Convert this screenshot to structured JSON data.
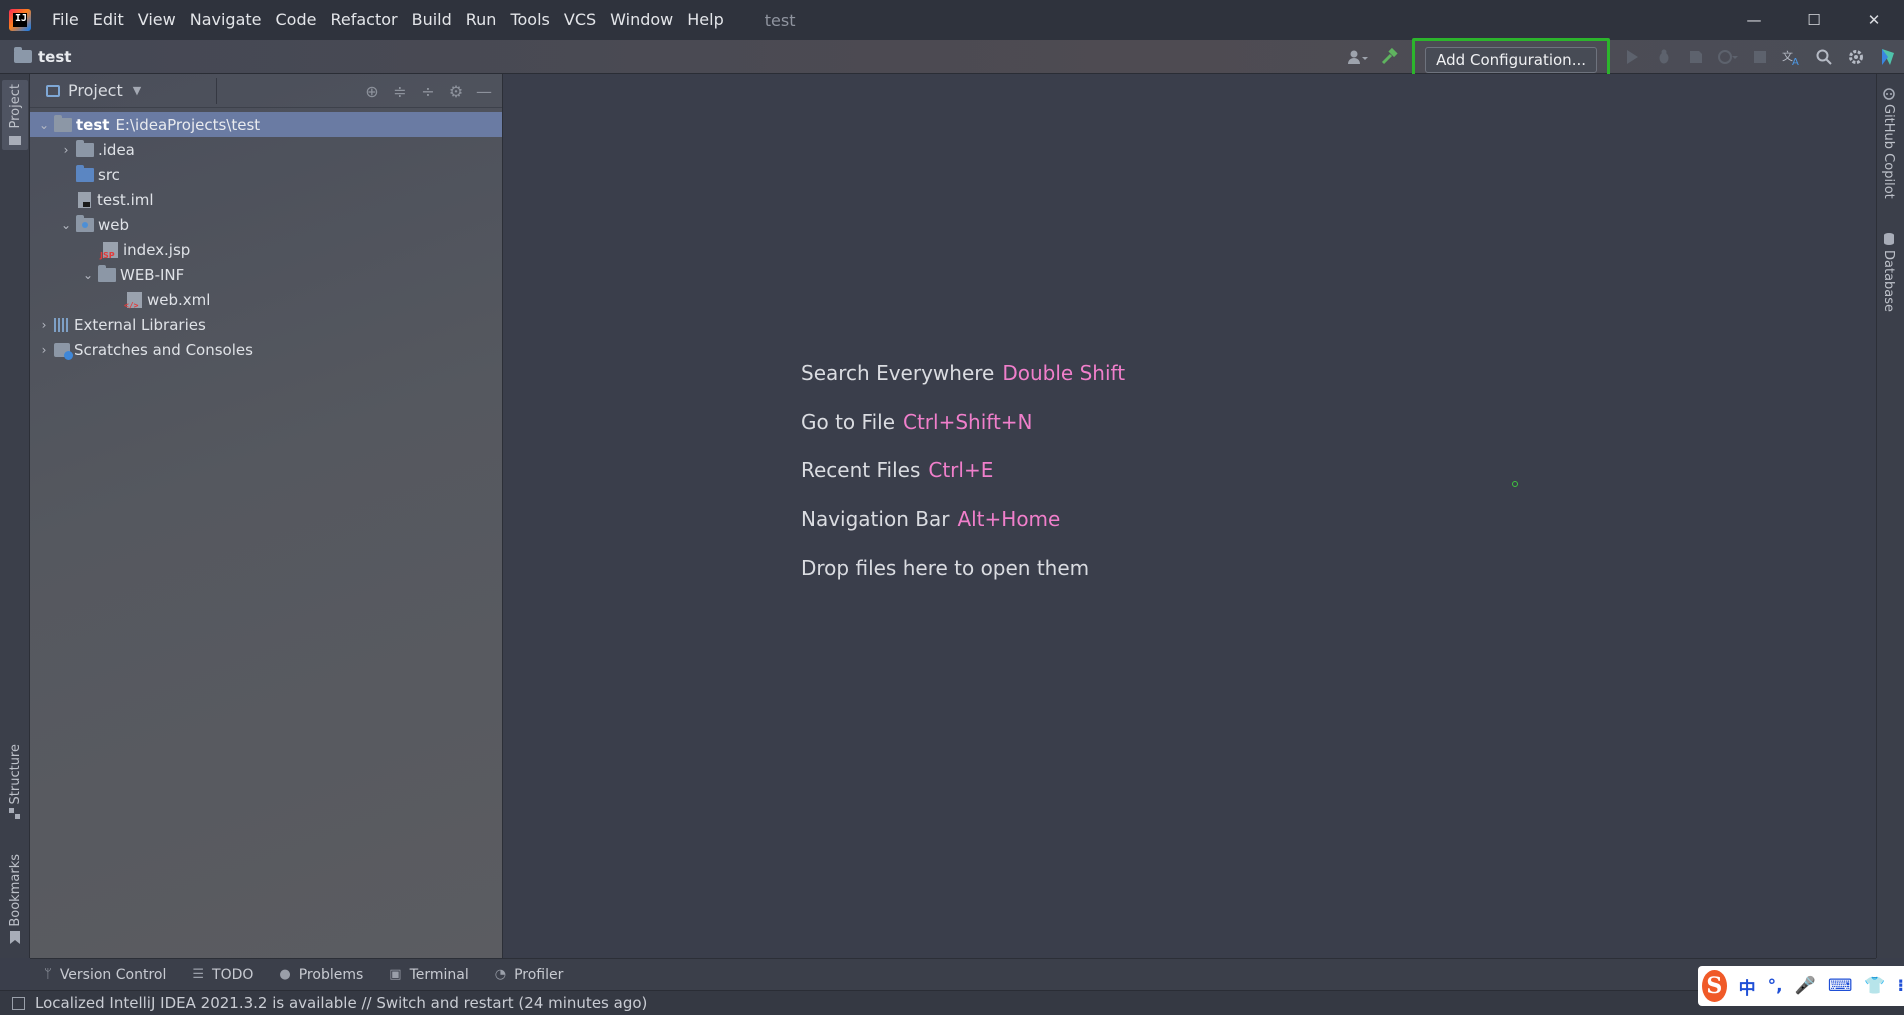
{
  "titlebar": {
    "menu": [
      "File",
      "Edit",
      "View",
      "Navigate",
      "Code",
      "Refactor",
      "Build",
      "Run",
      "Tools",
      "VCS",
      "Window",
      "Help"
    ],
    "window_title": "test",
    "minimize": "—",
    "maximize": "☐",
    "close": "✕"
  },
  "navbar": {
    "project": "test",
    "add_config_label": "Add Configuration..."
  },
  "left_stripe": {
    "project": "Project",
    "structure": "Structure",
    "bookmarks": "Bookmarks"
  },
  "project_panel": {
    "title": "Project",
    "tree": {
      "root_name": "test",
      "root_path": "E:\\ideaProjects\\test",
      "idea": ".idea",
      "src": "src",
      "iml": "test.iml",
      "web": "web",
      "index": "index.jsp",
      "webinf": "WEB-INF",
      "webxml": "web.xml",
      "libraries": "External Libraries",
      "scratches": "Scratches and Consoles"
    }
  },
  "editor": {
    "hints": [
      {
        "label": "Search Everywhere",
        "key": "Double Shift"
      },
      {
        "label": "Go to File",
        "key": "Ctrl+Shift+N"
      },
      {
        "label": "Recent Files",
        "key": "Ctrl+E"
      },
      {
        "label": "Navigation Bar",
        "key": "Alt+Home"
      }
    ],
    "drop_hint": "Drop files here to open them"
  },
  "right_stripe": {
    "copilot": "GitHub Copilot",
    "database": "Database"
  },
  "bottom_tabs": [
    "Version Control",
    "TODO",
    "Problems",
    "Terminal",
    "Profiler"
  ],
  "status": {
    "message": "Localized IntelliJ IDEA 2021.3.2 is available // Switch and restart (24 minutes ago)"
  },
  "ime": {
    "logo": "S",
    "items": [
      "中",
      "°,",
      "🎤",
      "⌨",
      "👕",
      "⁝"
    ]
  },
  "colors": {
    "shortcut": "#f07fcb",
    "highlight_frame": "#2cb52c",
    "selection": "#6a7ba3"
  }
}
